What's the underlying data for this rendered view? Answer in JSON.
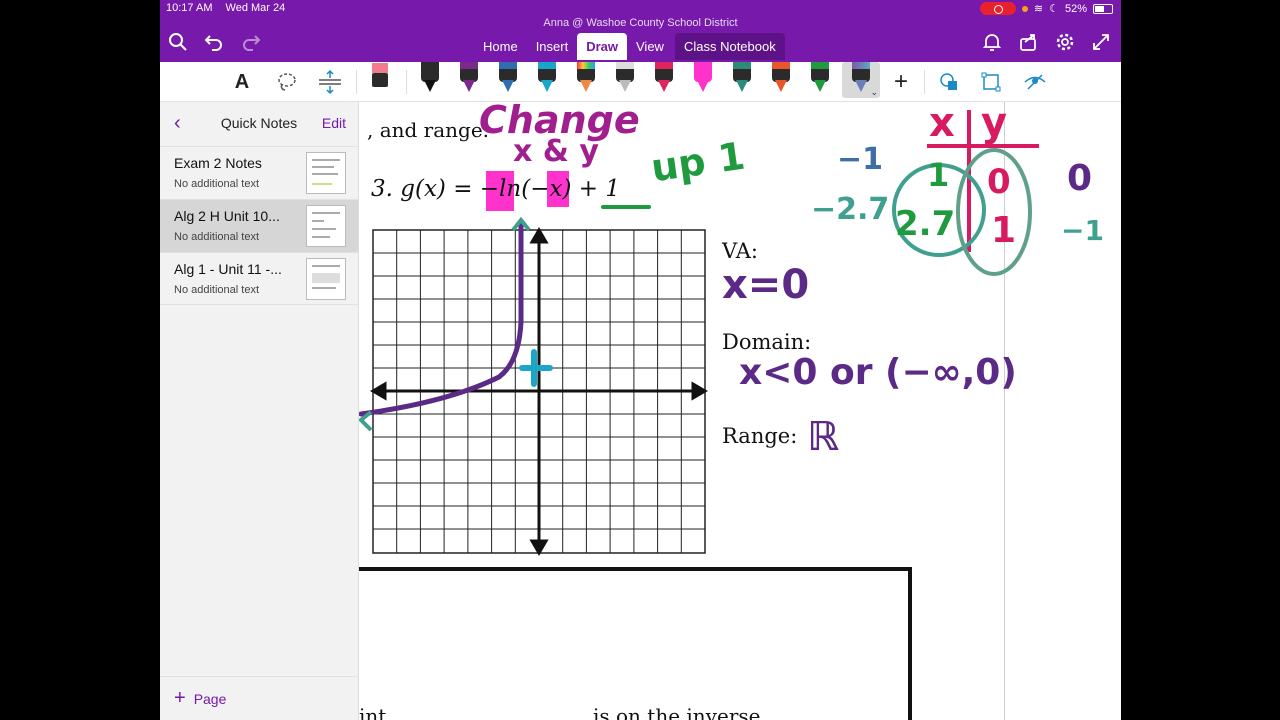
{
  "status": {
    "time": "10:17 AM",
    "date": "Wed Mar 24",
    "battery": "52%"
  },
  "account": "Anna @ Washoe County School District",
  "tabs": [
    "Home",
    "Insert",
    "Draw",
    "View",
    "Class Notebook"
  ],
  "active_tab": "Draw",
  "toolbar": {
    "text_tool": "A"
  },
  "sidebar": {
    "title": "Quick Notes",
    "edit": "Edit",
    "add_page": "Page",
    "pages": [
      {
        "title": "Exam 2 Notes",
        "subtitle": "No additional text"
      },
      {
        "title": "Alg 2 H Unit 10...",
        "subtitle": "No additional text"
      },
      {
        "title": "Alg 1 - Unit 11 -...",
        "subtitle": "No additional text"
      }
    ]
  },
  "worksheet": {
    "intro": ", and range.",
    "problem": "3.  g(x) = −ln(−x) + 1",
    "va_label": "VA:",
    "domain_label": "Domain:",
    "range_label": "Range:",
    "bottom_left": "int",
    "bottom_right": "is on the inverse"
  },
  "annotations": {
    "change": "Change",
    "x_and_y": "x & y",
    "up1": "up 1",
    "va_answer": "x=0",
    "domain_answer": "x<0 or (−∞,0)",
    "range_answer": "ℝ",
    "table_header_x": "x",
    "table_header_y": "y",
    "table_left": [
      "−1",
      "−2.7"
    ],
    "table_x": [
      "1",
      "2.7"
    ],
    "table_y": [
      "0",
      "1"
    ],
    "table_right": [
      "0",
      "−1"
    ]
  },
  "colors": {
    "onenote_purple": "#7719aa",
    "ink_magenta": "#d81b60",
    "ink_green": "#1f9a3e",
    "ink_purple": "#5b2a86",
    "ink_teal": "#3fa090",
    "ink_cyan": "#1aa6c9",
    "highlight_pink": "#ff33cc"
  }
}
